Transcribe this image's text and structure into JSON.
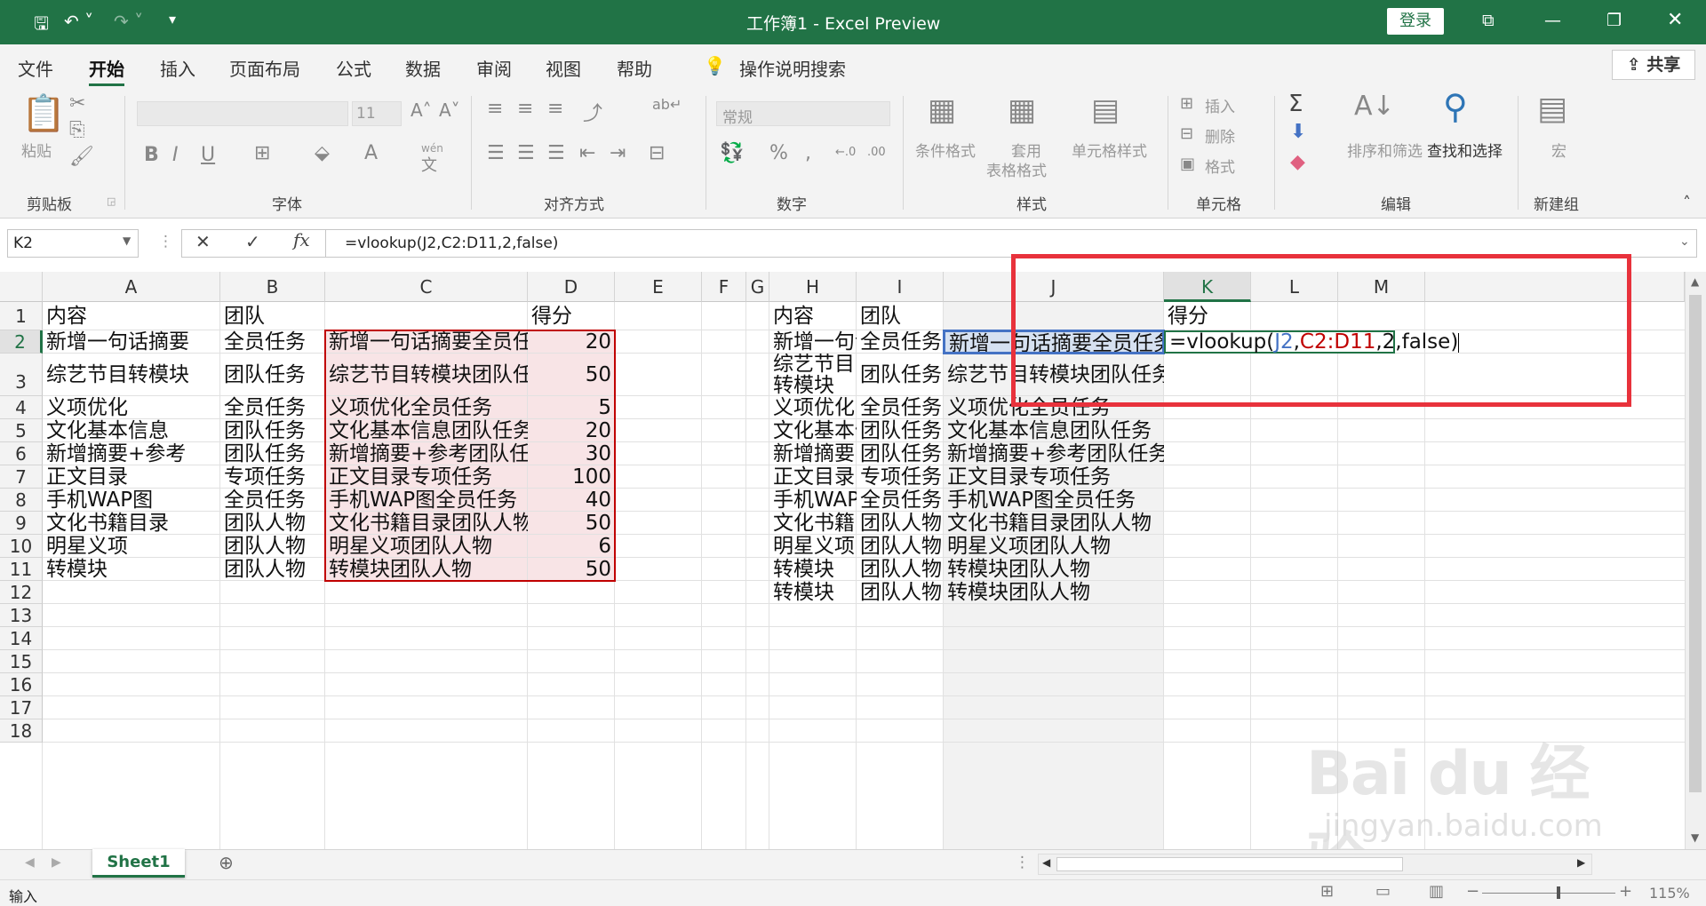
{
  "titlebar": {
    "title": "工作簿1  -  Excel Preview",
    "login": "登录"
  },
  "menu": {
    "file": "文件",
    "home": "开始",
    "insert": "插入",
    "layout": "页面布局",
    "formulas": "公式",
    "data": "数据",
    "review": "审阅",
    "view": "视图",
    "help": "帮助",
    "search": "操作说明搜索",
    "share": "共享"
  },
  "ribbon": {
    "paste": "粘贴",
    "font_size": "11",
    "number_format": "常规",
    "wen": "wén",
    "wen2": "文",
    "cond_format": "条件格式",
    "table_format_1": "套用",
    "table_format_2": "表格格式",
    "cell_styles": "单元格样式",
    "insert": "插入",
    "delete": "删除",
    "format": "格式",
    "sort_filter": "排序和筛选",
    "find_select": "查找和选择",
    "macro": "宏",
    "groups": {
      "clipboard": "剪贴板",
      "font": "字体",
      "alignment": "对齐方式",
      "number": "数字",
      "styles": "样式",
      "cells": "单元格",
      "editing": "编辑",
      "newgroup": "新建组"
    }
  },
  "formula_bar": {
    "name_box": "K2",
    "formula": "=vlookup(J2,C2:D11,2,false)"
  },
  "columns": [
    "A",
    "B",
    "C",
    "D",
    "E",
    "F",
    "G",
    "H",
    "I",
    "J",
    "K",
    "L",
    "M"
  ],
  "rows": [
    "1",
    "2",
    "3",
    "4",
    "5",
    "6",
    "7",
    "8",
    "9",
    "10",
    "11",
    "12",
    "13",
    "14",
    "15",
    "16",
    "17",
    "18"
  ],
  "sheet": {
    "A": [
      "内容",
      "新增一句话摘要",
      "综艺节目转模块",
      "义项优化",
      "文化基本信息",
      "新增摘要+参考",
      "正文目录",
      "手机WAP图",
      "文化书籍目录",
      "明星义项",
      "转模块"
    ],
    "B": [
      "团队",
      "全员任务",
      "团队任务",
      "全员任务",
      "团队任务",
      "团队任务",
      "专项任务",
      "全员任务",
      "团队人物",
      "团队人物",
      "团队人物"
    ],
    "C": [
      "",
      "新增一句话摘要全员任务",
      "综艺节目转模块团队任务",
      "义项优化全员任务",
      "文化基本信息团队任务",
      "新增摘要+参考团队任务",
      "正文目录专项任务",
      "手机WAP图全员任务",
      "文化书籍目录团队人物",
      "明星义项团队人物",
      "转模块团队人物"
    ],
    "D": [
      "得分",
      "20",
      "50",
      "5",
      "20",
      "30",
      "100",
      "40",
      "50",
      "6",
      "50"
    ],
    "H": [
      "内容",
      "新增一句话",
      "综艺节目",
      "义项优化",
      "文化基本信",
      "新增摘要+",
      "正文目录",
      "手机WAP图",
      "文化书籍目",
      "明星义项",
      "转模块",
      "转模块"
    ],
    "H3b": "转模块",
    "I": [
      "团队",
      "全员任务",
      "团队任务",
      "全员任务",
      "团队任务",
      "团队任务",
      "专项任务",
      "全员任务",
      "团队人物",
      "团队人物",
      "团队人物",
      "团队人物"
    ],
    "J": [
      "",
      "新增一句话摘要全员任务",
      "综艺节目转模块团队任务",
      "义项优化全员任务",
      "文化基本信息团队任务",
      "新增摘要+参考团队任务",
      "正文目录专项任务",
      "手机WAP图全员任务",
      "文化书籍目录团队人物",
      "明星义项团队人物",
      "转模块团队人物",
      "转模块团队人物"
    ],
    "K1": "得分",
    "K2_parts": [
      "=vlookup(",
      "J2",
      ",",
      "C2:D11",
      ",2,false)"
    ]
  },
  "tabs": {
    "sheet1": "Sheet1"
  },
  "status": {
    "mode": "输入",
    "zoom": "115%"
  },
  "watermark": {
    "text": "Bai du 经验",
    "url": "jingyan.baidu.com"
  },
  "colors": {
    "excel_green": "#217346",
    "ref_blue": "#4472c4",
    "ref_red": "#c00000",
    "highlight": "#e8e8e8",
    "annotation": "#e8323c"
  }
}
